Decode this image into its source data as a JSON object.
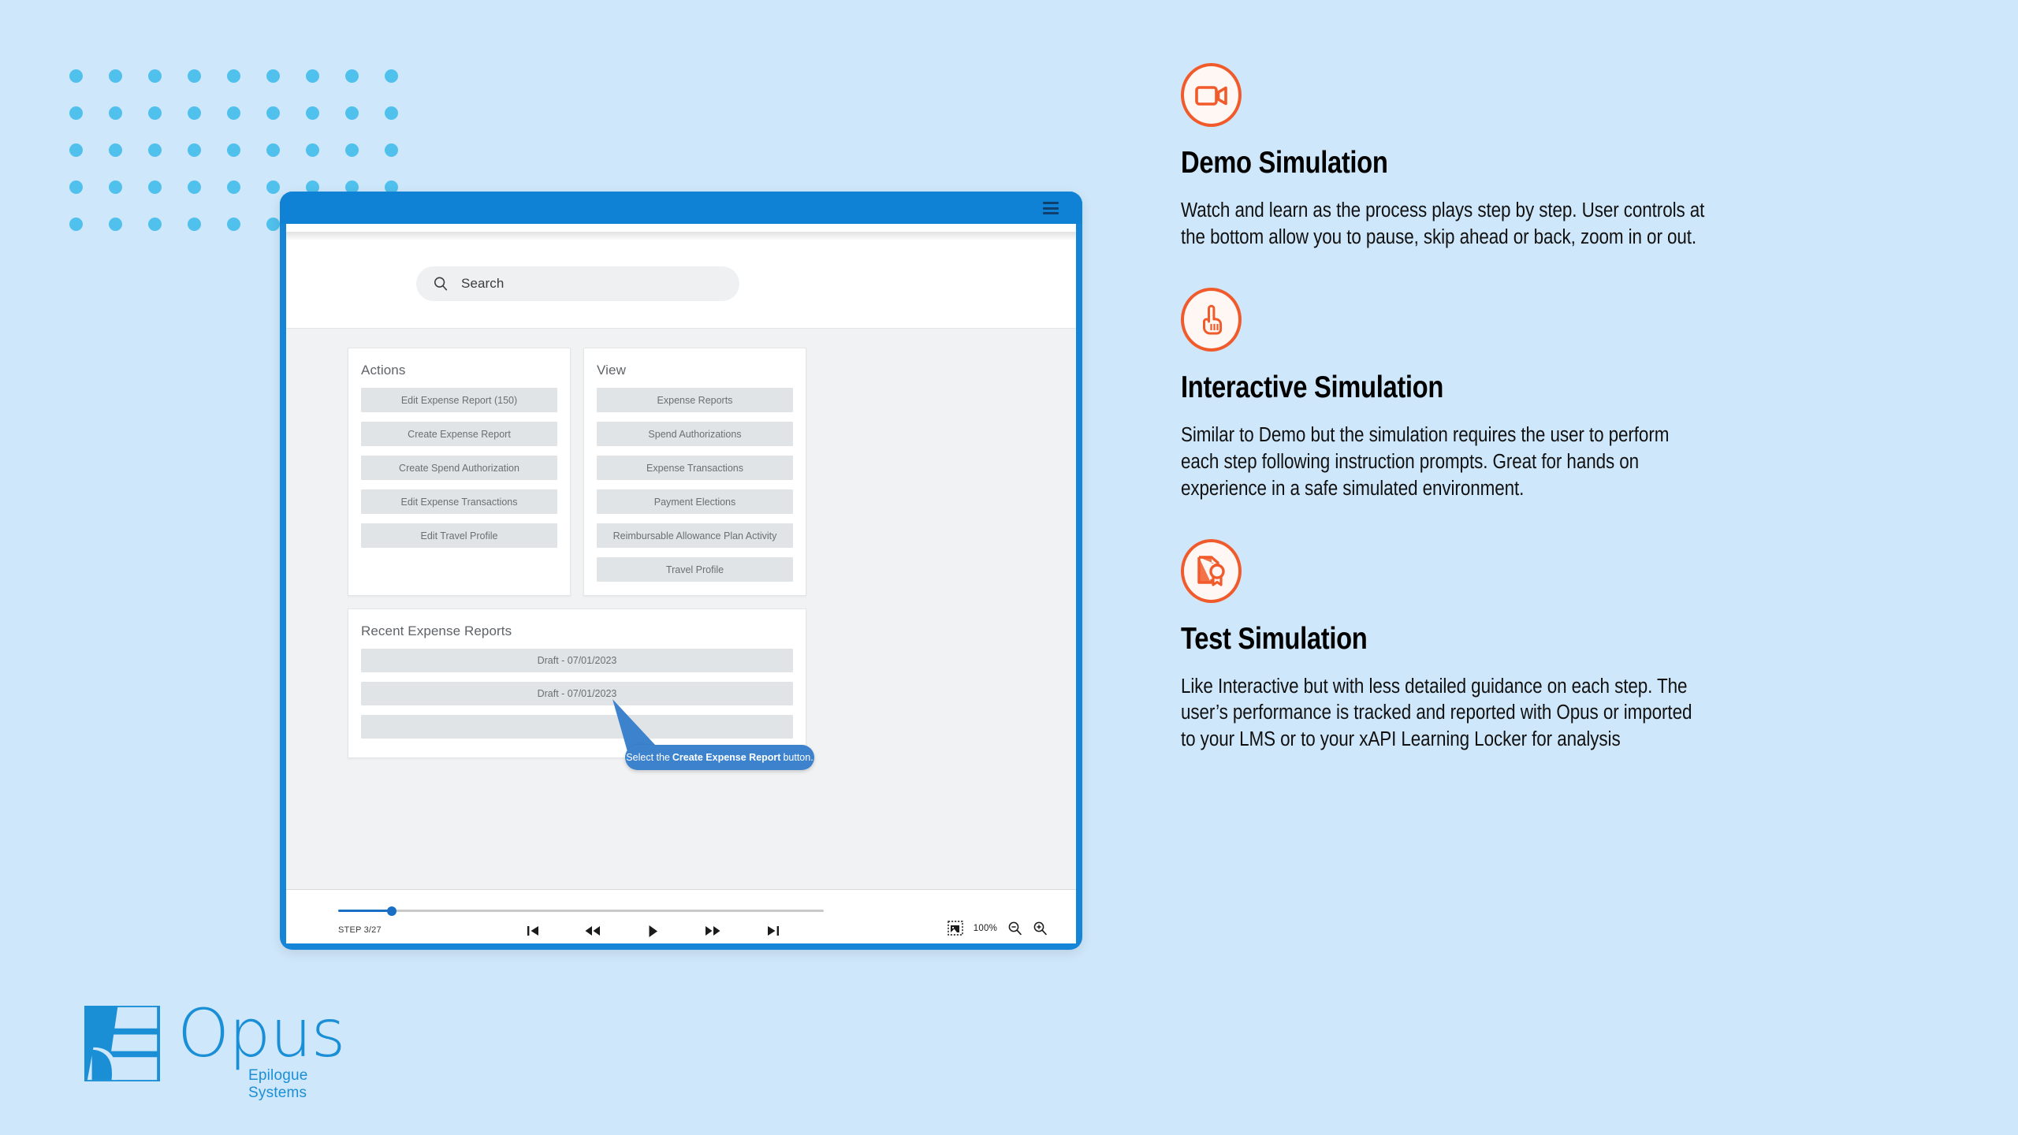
{
  "theme": {
    "page_background": "#cfe7fa",
    "dot_color": "#4fc1ec",
    "window_chrome": "#1082d6",
    "accent_orange": "#f15a2b",
    "tooltip_blue": "#3c82cd",
    "logo_blue": "#1a8fd6"
  },
  "simulator": {
    "menu_icon": "hamburger-icon",
    "search": {
      "icon": "search-icon",
      "placeholder": "Search",
      "value": ""
    },
    "actions_panel": {
      "title": "Actions",
      "buttons": [
        "Edit Expense Report (150)",
        "Create Expense Report",
        "Create Spend Authorization",
        "Edit Expense Transactions",
        "Edit Travel Profile"
      ]
    },
    "view_panel": {
      "title": "View",
      "buttons": [
        "Expense Reports",
        "Spend Authorizations",
        "Expense Transactions",
        "Payment Elections",
        "Reimbursable Allowance Plan Activity",
        "Travel Profile"
      ]
    },
    "recent_panel": {
      "title": "Recent Expense Reports",
      "items": [
        "Draft - 07/01/2023",
        "Draft - 07/01/2023",
        ""
      ]
    },
    "tooltip": {
      "prefix": "Select the ",
      "bold": "Create Expense Report",
      "suffix": " button."
    },
    "player": {
      "step_label": "STEP 3/27",
      "progress_percent": 11,
      "zoom_level": "100%",
      "controls": [
        {
          "name": "first-step-button",
          "glyph": "first"
        },
        {
          "name": "rewind-button",
          "glyph": "rewind"
        },
        {
          "name": "play-button",
          "glyph": "play"
        },
        {
          "name": "fast-forward-button",
          "glyph": "forward"
        },
        {
          "name": "last-step-button",
          "glyph": "last"
        }
      ],
      "fit_icon": "fit-to-screen-icon",
      "zoom_out_icon": "zoom-out-icon",
      "zoom_in_icon": "zoom-in-icon"
    }
  },
  "features": [
    {
      "icon": "video-camera-icon",
      "title": "Demo Simulation",
      "body": "Watch and learn as the process plays step by step. User controls at the bottom allow you to pause, skip ahead or back, zoom in or out."
    },
    {
      "icon": "pointing-hand-icon",
      "title": "Interactive Simulation",
      "body": "Similar to Demo but the simulation requires the user to perform each step following instruction prompts. Great for hands on experience in a safe simulated environment."
    },
    {
      "icon": "certificate-award-icon",
      "title": "Test Simulation",
      "body": "Like Interactive but with less detailed guidance on each step. The user’s performance is tracked and reported with Opus or imported to your LMS or to your xAPI Learning Locker for analysis"
    }
  ],
  "logo": {
    "mark": "opus-logo-mark",
    "wordmark": "Opus",
    "tagline": "Epilogue Systems"
  }
}
